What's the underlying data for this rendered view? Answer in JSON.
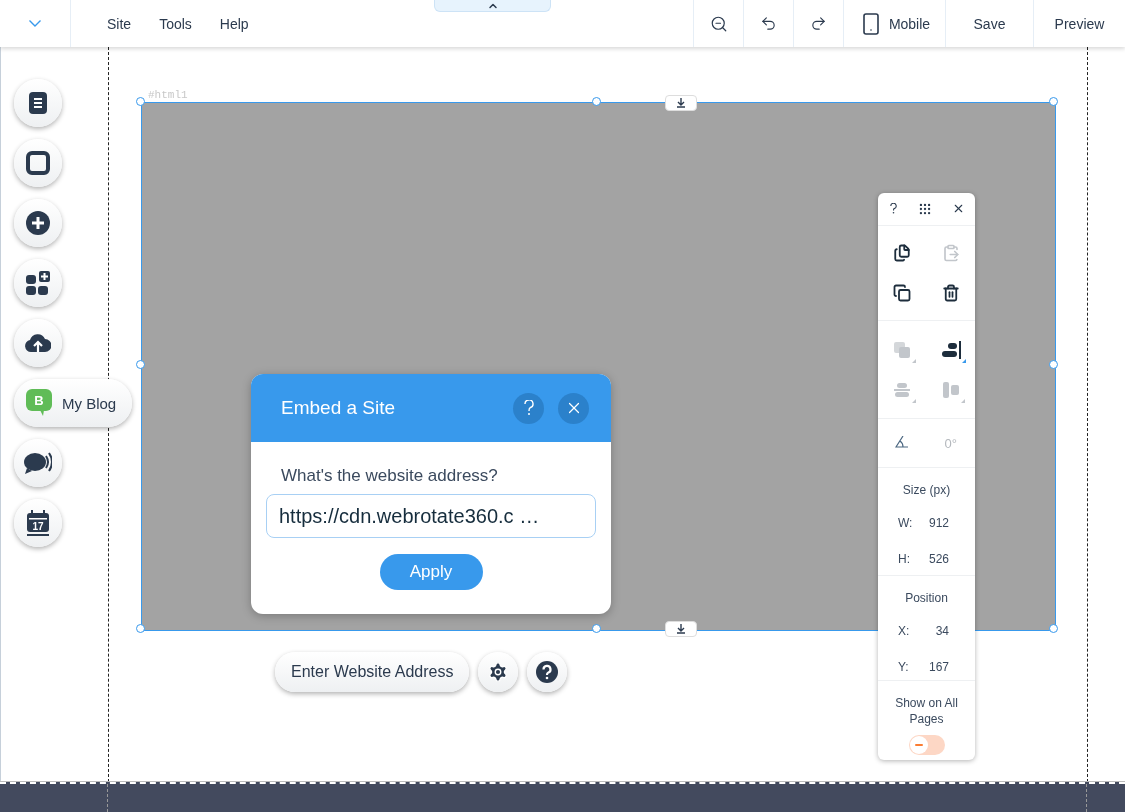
{
  "top_bar": {
    "menu": [
      "Site",
      "Tools",
      "Help"
    ],
    "mobile_label": "Mobile",
    "save_label": "Save",
    "preview_label": "Preview"
  },
  "rail": [
    {
      "kind": "pages"
    },
    {
      "kind": "background"
    },
    {
      "kind": "add"
    },
    {
      "kind": "apps"
    },
    {
      "kind": "upload"
    },
    {
      "kind": "blog",
      "label": "My Blog",
      "icon_text": "B"
    },
    {
      "kind": "chat"
    },
    {
      "kind": "events",
      "icon_text": "17"
    }
  ],
  "element": {
    "id_label": "#html1"
  },
  "dialog": {
    "title": "Embed a Site",
    "question": "What's the website address?",
    "value": "https://cdn.webrotate360.c …",
    "apply_label": "Apply"
  },
  "element_toolbar": {
    "label": "Enter Website Address"
  },
  "panel": {
    "edit_tools": [
      {
        "kind": "copy",
        "disabled": false
      },
      {
        "kind": "paste",
        "disabled": true
      },
      {
        "kind": "duplicate",
        "disabled": false
      },
      {
        "kind": "delete",
        "disabled": false
      }
    ],
    "arrange_tools": [
      {
        "kind": "arrange",
        "disabled": true
      },
      {
        "kind": "align",
        "disabled": false
      },
      {
        "kind": "distribute",
        "disabled": true
      },
      {
        "kind": "match",
        "disabled": true
      }
    ],
    "rotation": "0°",
    "size_title": "Size (px)",
    "size": [
      {
        "label": "W:",
        "value": "912"
      },
      {
        "label": "H:",
        "value": "526"
      }
    ],
    "position_title": "Position",
    "position": [
      {
        "label": "X:",
        "value": "34"
      },
      {
        "label": "Y:",
        "value": "167"
      }
    ],
    "show_on_all_pages": {
      "label": "Show on All Pages",
      "on": false
    }
  }
}
